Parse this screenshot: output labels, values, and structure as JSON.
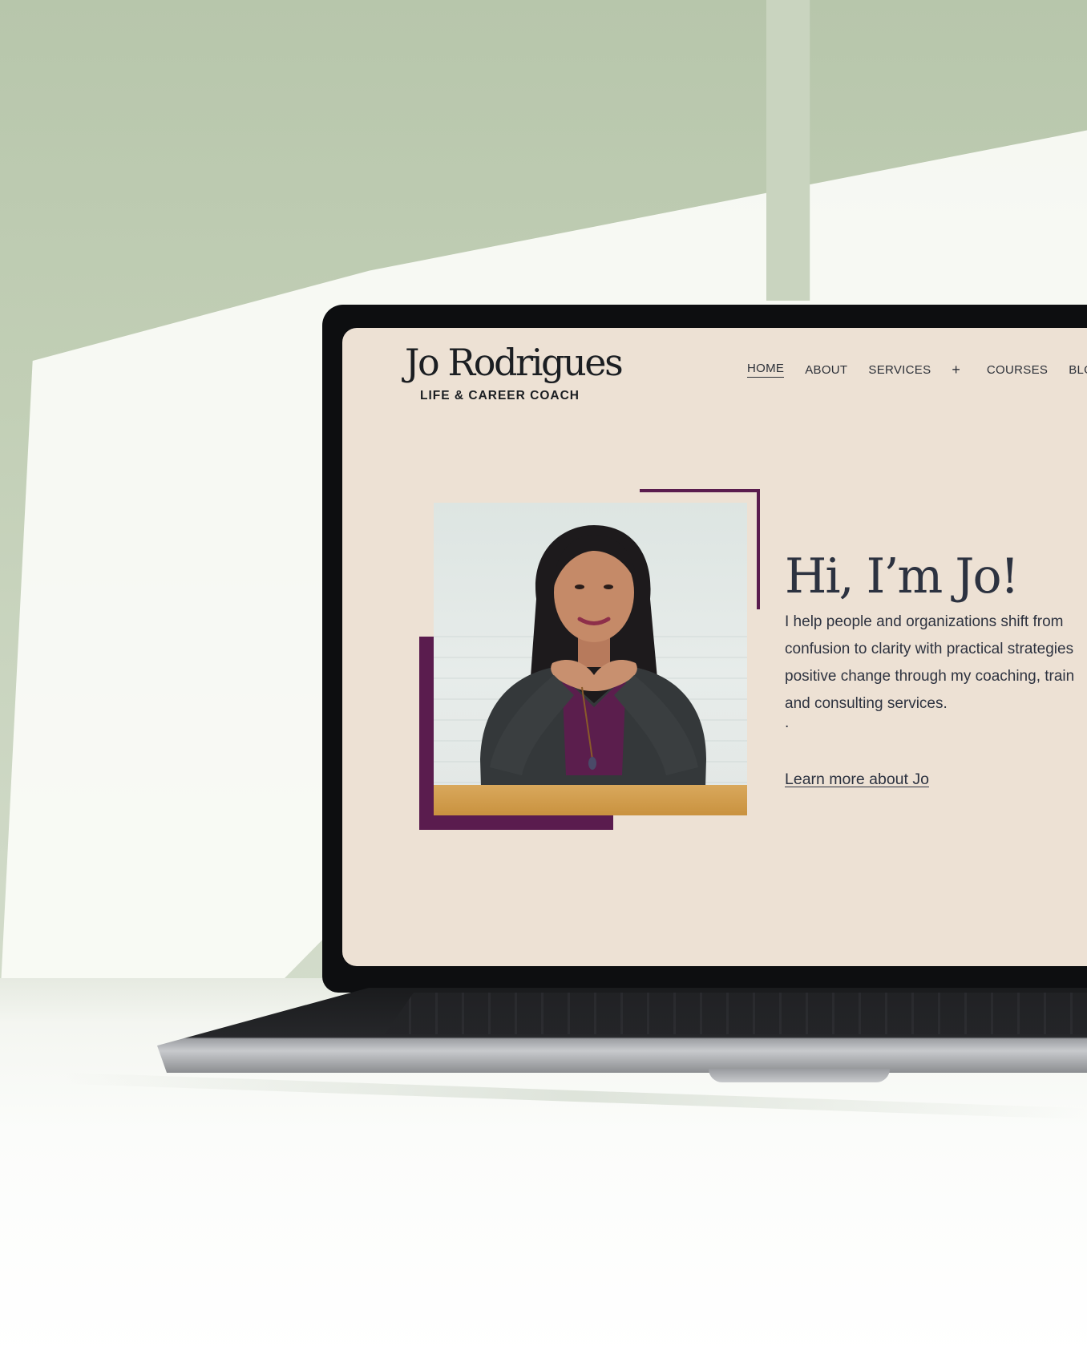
{
  "logo": {
    "name": "Jo Rodrigues",
    "subtitle": "LIFE & CAREER COACH"
  },
  "nav": {
    "items": [
      {
        "label": "HOME",
        "active": true
      },
      {
        "label": "ABOUT",
        "active": false
      },
      {
        "label": "SERVICES",
        "active": false
      },
      {
        "label": "+",
        "active": false
      },
      {
        "label": "COURSES",
        "active": false
      },
      {
        "label": "BLOG",
        "active": false
      }
    ]
  },
  "hero": {
    "title": "Hi, I’m Jo!",
    "body_lines": [
      "I help people and organizations shift from",
      "confusion to clarity with practical strategies",
      "positive change through my coaching, train",
      "and consulting services."
    ],
    "trailing_mark": ".",
    "link_label": "Learn more about Jo"
  },
  "colors": {
    "screen_background": "#ede1d4",
    "accent_plum": "#5a1c4e",
    "text_dark": "#2c3240"
  }
}
